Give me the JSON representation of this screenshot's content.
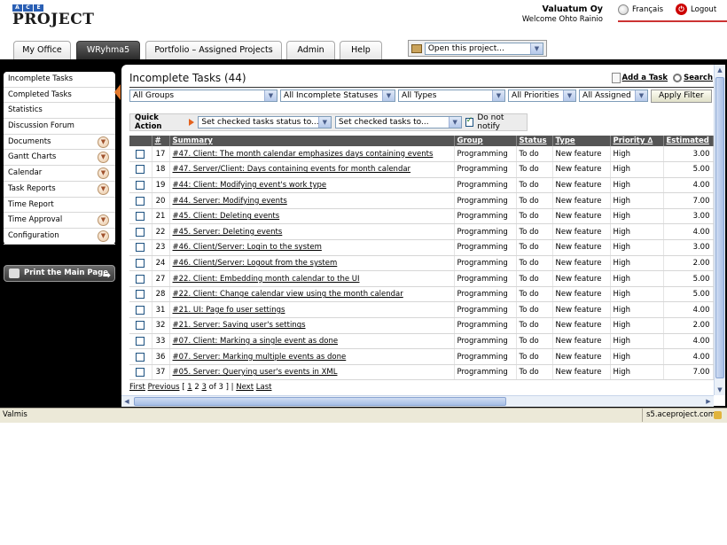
{
  "header": {
    "logo_top": [
      "A",
      "C",
      "E"
    ],
    "logo_main": "PROJECT",
    "company": "Valuatum Oy",
    "welcome": "Welcome Ohto Rainio",
    "lang_link": "Français",
    "logout_link": "Logout"
  },
  "tabs": [
    "My Office",
    "WRyhma5",
    "Portfolio – Assigned Projects",
    "Admin",
    "Help"
  ],
  "project_select": {
    "value": "Open this project..."
  },
  "sidebar": {
    "items": [
      "Incomplete Tasks",
      "Completed Tasks",
      "Statistics",
      "Discussion Forum",
      "Documents",
      "Gantt Charts",
      "Calendar",
      "Task Reports",
      "Time Report",
      "Time Approval",
      "Configuration"
    ],
    "print_button": "Print the Main Page"
  },
  "panel": {
    "title": "Incomplete Tasks (44)",
    "add_task": "Add a Task",
    "search": "Search"
  },
  "filters": {
    "groups": "All Groups",
    "statuses": "All Incomplete Statuses",
    "types": "All Types",
    "priorities": "All Priorities",
    "assigned": "All Assigned",
    "apply": "Apply Filter"
  },
  "quick_action": {
    "label": "Quick Action",
    "status_select": "Set checked tasks status to...",
    "tasks_select": "Set checked tasks to...",
    "notify_label": "Do not notify"
  },
  "table": {
    "columns": [
      "#",
      "Summary",
      "Group",
      "Status",
      "Type",
      "Priority ∆",
      "Estimated"
    ],
    "rows": [
      [
        "17",
        "#47. Client: The month calendar emphasizes days containing events",
        "Programming",
        "To do",
        "New feature",
        "High",
        "3.00"
      ],
      [
        "18",
        "#47. Server/Client: Days containing events for month calendar",
        "Programming",
        "To do",
        "New feature",
        "High",
        "5.00"
      ],
      [
        "19",
        "#44: Client: Modifying event's work type",
        "Programming",
        "To do",
        "New feature",
        "High",
        "4.00"
      ],
      [
        "20",
        "#44. Server: Modifying events",
        "Programming",
        "To do",
        "New feature",
        "High",
        "7.00"
      ],
      [
        "21",
        "#45. Client: Deleting events",
        "Programming",
        "To do",
        "New feature",
        "High",
        "3.00"
      ],
      [
        "22",
        "#45. Server: Deleting events",
        "Programming",
        "To do",
        "New feature",
        "High",
        "4.00"
      ],
      [
        "23",
        "#46. Client/Server: Login to the system",
        "Programming",
        "To do",
        "New feature",
        "High",
        "3.00"
      ],
      [
        "24",
        "#46. Client/Server: Logout from the system",
        "Programming",
        "To do",
        "New feature",
        "High",
        "2.00"
      ],
      [
        "27",
        "#22. Client: Embedding month calendar to the UI",
        "Programming",
        "To do",
        "New feature",
        "High",
        "5.00"
      ],
      [
        "28",
        "#22. Client: Change calendar view using the month calendar",
        "Programming",
        "To do",
        "New feature",
        "High",
        "5.00"
      ],
      [
        "31",
        "#21. UI: Page fo user settings",
        "Programming",
        "To do",
        "New feature",
        "High",
        "4.00"
      ],
      [
        "32",
        "#21. Server: Saving user's settings",
        "Programming",
        "To do",
        "New feature",
        "High",
        "2.00"
      ],
      [
        "33",
        "#07. Client: Marking a single event as done",
        "Programming",
        "To do",
        "New feature",
        "High",
        "4.00"
      ],
      [
        "36",
        "#07. Server: Marking multiple events as done",
        "Programming",
        "To do",
        "New feature",
        "High",
        "4.00"
      ],
      [
        "37",
        "#05. Server: Querying user's events in XML",
        "Programming",
        "To do",
        "New feature",
        "High",
        "7.00"
      ]
    ]
  },
  "pager": {
    "first": "First",
    "previous": "Previous",
    "open": "[",
    "p1": "1",
    "p2": "2",
    "p3": "3",
    "of": "of 3 ]",
    "next": "Next",
    "last": "Last",
    "sep": "|"
  },
  "statusbar": {
    "left": "Valmis",
    "right": "s5.aceproject.com"
  }
}
